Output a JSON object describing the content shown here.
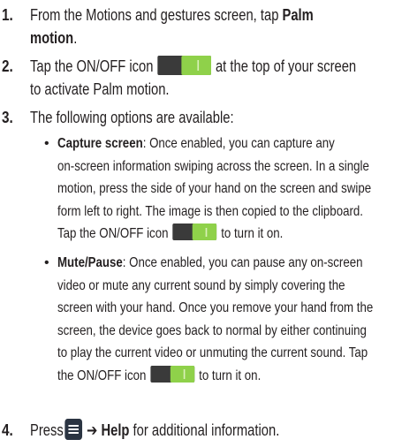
{
  "steps": [
    {
      "num": "1.",
      "prefix": "From the Motions and gestures screen, tap ",
      "bold": "Palm",
      "line2_bold": "motion",
      "line2_rest": "."
    },
    {
      "num": "2.",
      "line1_a": "Tap the ON/OFF icon",
      "line1_b": "at the top of your screen",
      "line2": "to activate Palm motion."
    },
    {
      "num": "3.",
      "line1": "The following options are available:"
    },
    {
      "num": "4.",
      "prefix": "Press",
      "arrow": "➔",
      "bold": "Help",
      "suffix": " for additional information."
    }
  ],
  "options": [
    {
      "bullet": "•",
      "title": "Capture screen",
      "lines": [
        ": Once enabled, you can capture any",
        "on-screen information swiping across the screen. In a single",
        "motion, press the side of your hand on the screen and swipe",
        "form left to right. The image is then copied to the clipboard."
      ],
      "last_a": "Tap the ON/OFF icon",
      "last_b": "to turn it on."
    },
    {
      "bullet": "•",
      "title": "Mute/Pause",
      "lines": [
        ": Once enabled, you can pause any on-screen",
        "video or mute any current sound by simply covering the",
        "screen with your hand. Once you remove your hand from the",
        "screen, the device goes back to normal by either continuing",
        "to play the current video or unmuting the current sound. Tap"
      ],
      "last_a": "the ON/OFF icon",
      "last_b": "to turn it on."
    }
  ],
  "icons": {
    "toggle": "on-off-toggle-icon",
    "menu": "menu-key-icon"
  },
  "colors": {
    "text": "#231f20",
    "toggle_dark": "#3a3a3a",
    "toggle_green": "#8fd14a",
    "menu_icon": "#2b3442"
  }
}
